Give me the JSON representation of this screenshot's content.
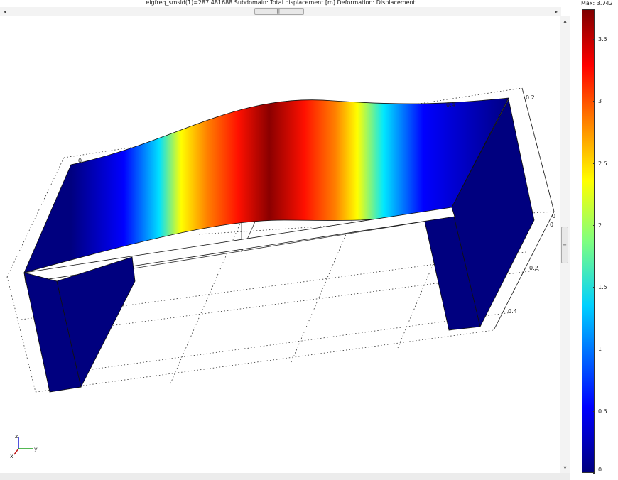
{
  "plot": {
    "title": "eigfreq_smsld(1)=287.481688    Subdomain: Total displacement [m]    Deformation: Displacement"
  },
  "scrollbars": {
    "h_left": "◂",
    "h_right": "▸",
    "h_thumb": "|||",
    "v_up": "▴",
    "v_down": "▾",
    "v_thumb": "≡"
  },
  "axes": {
    "top_right": "0.2",
    "top_mid": "0.4",
    "left_zero": "0",
    "right_zero_a": "0",
    "right_zero_b": "0",
    "tick_02": "0.2",
    "tick_04": "0.4",
    "triad_z": "z",
    "triad_y": "y",
    "triad_x": "x"
  },
  "colorbar": {
    "max_label": "Max: 3.742",
    "ticks": [
      {
        "value": 3.5,
        "label": "3.5"
      },
      {
        "value": 3,
        "label": "3"
      },
      {
        "value": 2.5,
        "label": "2.5"
      },
      {
        "value": 2,
        "label": "2"
      },
      {
        "value": 1.5,
        "label": "1.5"
      },
      {
        "value": 1,
        "label": "1"
      },
      {
        "value": 0.5,
        "label": "0.5"
      },
      {
        "value": 0,
        "label": "0"
      }
    ],
    "max_value": 3.742
  },
  "colors": {
    "deep_blue": "#00007f",
    "blue": "#0000ff",
    "cyan": "#00d0ff",
    "yellow": "#ffff00",
    "orange": "#ff7f00",
    "red": "#ff0000",
    "dark_red": "#7f0000"
  }
}
